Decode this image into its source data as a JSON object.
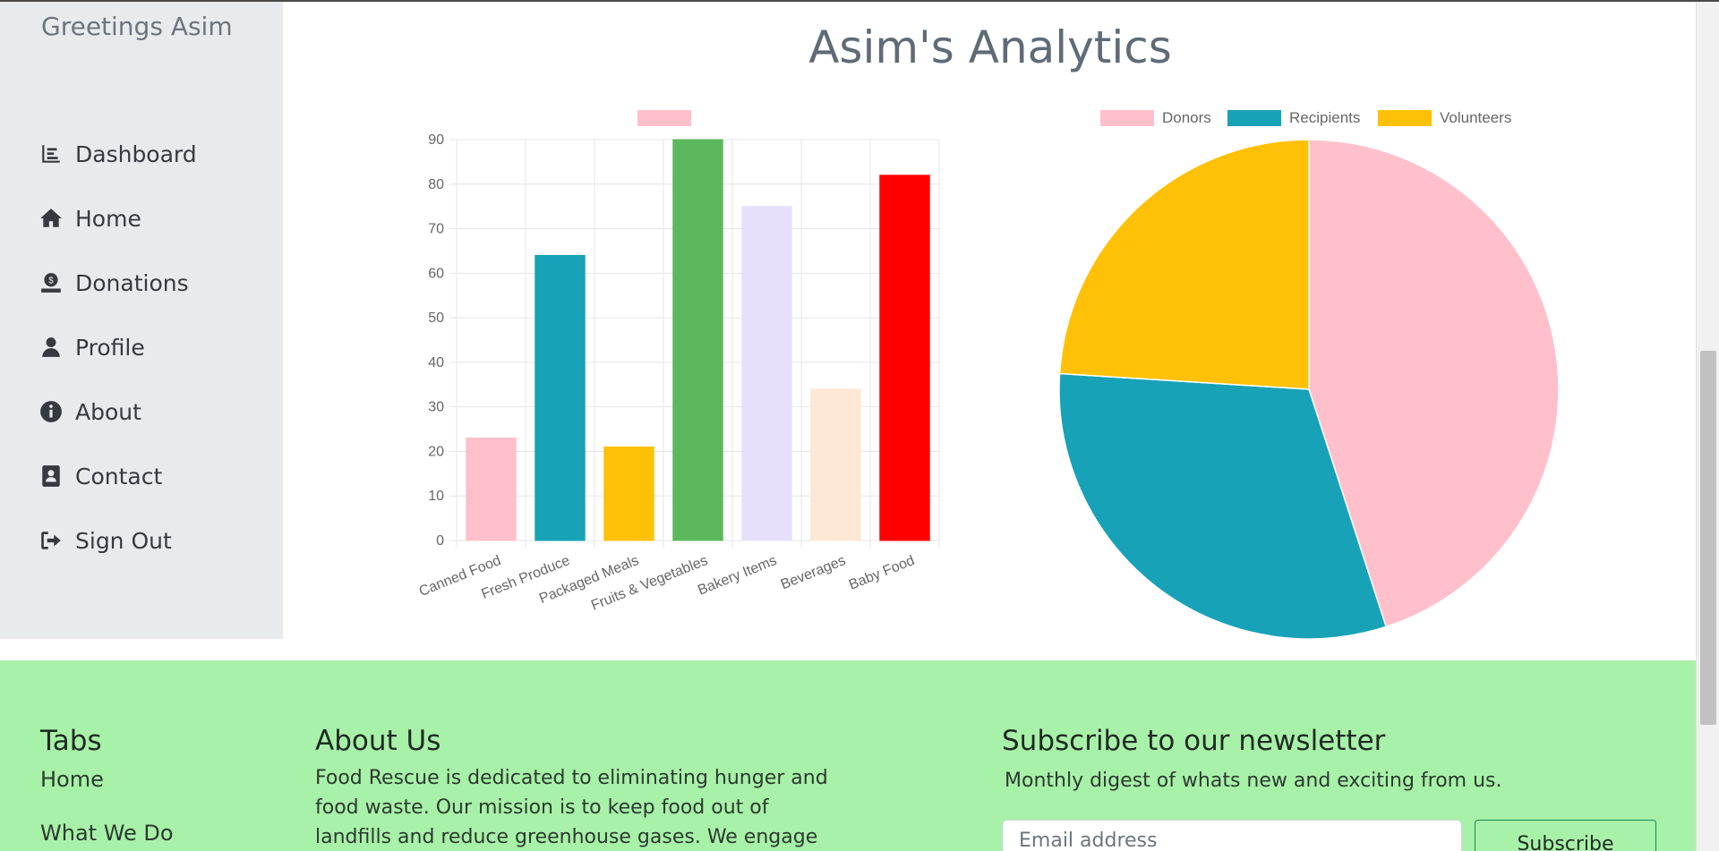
{
  "sidebar": {
    "greeting": "Greetings Asim",
    "items": [
      {
        "label": "Dashboard",
        "icon": "chart-bar-icon"
      },
      {
        "label": "Home",
        "icon": "home-icon"
      },
      {
        "label": "Donations",
        "icon": "donate-icon"
      },
      {
        "label": "Profile",
        "icon": "user-icon"
      },
      {
        "label": "About",
        "icon": "info-circle-icon"
      },
      {
        "label": "Contact",
        "icon": "address-book-icon"
      },
      {
        "label": "Sign Out",
        "icon": "sign-out-icon"
      }
    ]
  },
  "main": {
    "title": "Asim's Analytics"
  },
  "chart_data": [
    {
      "type": "bar",
      "categories": [
        "Canned Food",
        "Fresh Produce",
        "Packaged Meals",
        "Fruits & Vegetables",
        "Bakery Items",
        "Beverages",
        "Baby Food"
      ],
      "values": [
        23,
        64,
        21,
        90,
        75,
        34,
        82
      ],
      "colors": [
        "#ffc0cb",
        "#17a2b8",
        "#ffc107",
        "#5cb85c",
        "#e6e0fc",
        "#fde8d6",
        "#ff0000"
      ],
      "legend_color": "#ffc0cb",
      "legend_label": "",
      "ylim": [
        0,
        90
      ],
      "yticks": [
        0,
        10,
        20,
        30,
        40,
        50,
        60,
        70,
        80,
        90
      ],
      "grid": true,
      "legend_position": "top"
    },
    {
      "type": "pie",
      "labels": [
        "Donors",
        "Recipients",
        "Volunteers"
      ],
      "values": [
        45,
        31,
        24
      ],
      "colors": [
        "#ffc0cb",
        "#17a2b8",
        "#ffc107"
      ],
      "legend_position": "top"
    }
  ],
  "footer": {
    "tabs_title": "Tabs",
    "tabs_links": [
      "Home",
      "What We Do"
    ],
    "about_title": "About Us",
    "about_text": "Food Rescue is dedicated to eliminating hunger and food waste. Our mission is to keep food out of landfills and reduce greenhouse gases. We engage volunteers",
    "newsletter_title": "Subscribe to our newsletter",
    "newsletter_subtitle": "Monthly digest of whats new and exciting from us.",
    "email_placeholder": "Email address",
    "subscribe_label": "Subscribe"
  }
}
